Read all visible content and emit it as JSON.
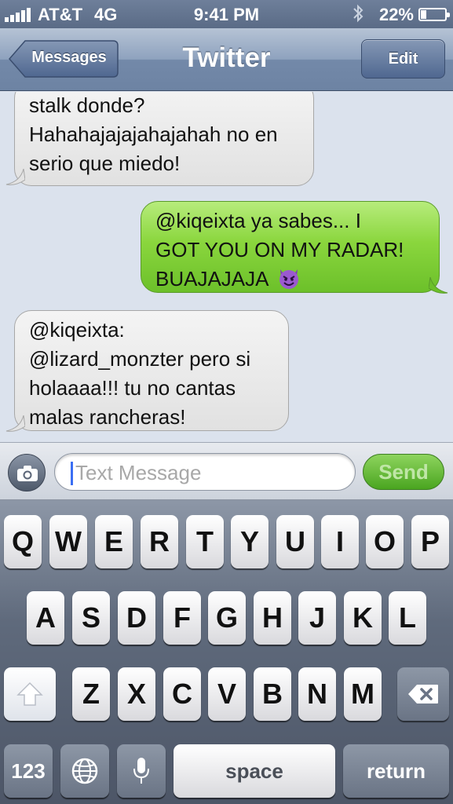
{
  "status_bar": {
    "carrier": "AT&T",
    "network": "4G",
    "time": "9:41 PM",
    "battery_percent": "22%",
    "battery_level": 0.22,
    "icons": [
      "signal-icon",
      "bluetooth-icon",
      "battery-icon"
    ]
  },
  "nav": {
    "back_label": "Messages",
    "title": "Twitter",
    "edit_label": "Edit"
  },
  "messages": [
    {
      "direction": "incoming",
      "lines": [
        "stalk donde?",
        "Hahahajajajahajahah no en",
        "serio que miedo!"
      ]
    },
    {
      "direction": "outgoing",
      "lines": [
        "@kiqeixta ya sabes... I",
        "GOT YOU ON MY RADAR!",
        "BUAJAJAJA"
      ],
      "emoji": "smiling-imp-icon"
    },
    {
      "direction": "incoming",
      "lines": [
        "@kiqeixta:",
        "@lizard_monzter pero si",
        "holaaaa!!! tu no cantas",
        "malas rancheras!"
      ]
    }
  ],
  "input": {
    "placeholder": "Text Message",
    "value": "",
    "send_label": "Send"
  },
  "keyboard": {
    "row1": [
      "Q",
      "W",
      "E",
      "R",
      "T",
      "Y",
      "U",
      "I",
      "O",
      "P"
    ],
    "row2": [
      "A",
      "S",
      "D",
      "F",
      "G",
      "H",
      "J",
      "K",
      "L"
    ],
    "row3": [
      "Z",
      "X",
      "C",
      "V",
      "B",
      "N",
      "M"
    ],
    "numbers_label": "123",
    "space_label": "space",
    "return_label": "return"
  },
  "colors": {
    "outgoing_bubble": "#8ad63d",
    "incoming_bubble": "#e9e9e9",
    "nav_bar": "#7389a9",
    "send_button": "#4aa520",
    "caret": "#3b6ff3"
  }
}
